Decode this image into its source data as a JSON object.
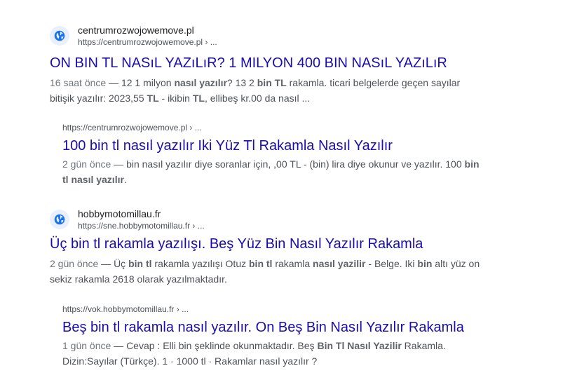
{
  "results": [
    {
      "site_name": "centrumrozwojowemove.pl",
      "url": "https://centrumrozwojowemove.pl › ...",
      "title": "ON BIN TL NASıL YAZıLıR? 1 MILYON 400 BIN NASıL YAZıLıR",
      "date": "16 saat önce",
      "snippet_parts": [
        {
          "t": " — 12 1 milyon ",
          "b": false
        },
        {
          "t": "nasıl yazılır",
          "b": true
        },
        {
          "t": "? 13 2 ",
          "b": false
        },
        {
          "t": "bin TL",
          "b": true
        },
        {
          "t": " rakamla. ticari belgelerde geçen sayılar bitişik yazılır: 2023,55 ",
          "b": false
        },
        {
          "t": "TL",
          "b": true
        },
        {
          "t": " - ikibin ",
          "b": false
        },
        {
          "t": "TL",
          "b": true
        },
        {
          "t": ", ellibeş kr.00 da nasıl ...",
          "b": false
        }
      ]
    },
    {
      "url": "https://centrumrozwojowemove.pl › ...",
      "title": "100 bin tl nasıl yazılır Iki Yüz Tl Rakamla Nasıl Yazılır",
      "date": "2 gün önce",
      "snippet_parts": [
        {
          "t": " — bin nasıl yazılır diye soranlar için, ,00 TL - (bin) lira diye okunur ve yazılır. 100 ",
          "b": false
        },
        {
          "t": "bin tl nasıl yazılır",
          "b": true
        },
        {
          "t": ".",
          "b": false
        }
      ]
    },
    {
      "site_name": "hobbymotomillau.fr",
      "url": "https://sne.hobbymotomillau.fr › ...",
      "title": "Üç bin tl rakamla yazılışı. Beş Yüz Bin Nasıl Yazılır Rakamla",
      "date": "2 gün önce",
      "snippet_parts": [
        {
          "t": " — Üç ",
          "b": false
        },
        {
          "t": "bin tl",
          "b": true
        },
        {
          "t": " rakamla yazılışı Otuz ",
          "b": false
        },
        {
          "t": "bin tl",
          "b": true
        },
        {
          "t": " rakamla ",
          "b": false
        },
        {
          "t": "nasıl yazilir",
          "b": true
        },
        {
          "t": " - Belge. Iki ",
          "b": false
        },
        {
          "t": "bin",
          "b": true
        },
        {
          "t": " altı yüz on sekiz rakamla 2618 olarak yazılmaktadır.",
          "b": false
        }
      ]
    },
    {
      "url": "https://vok.hobbymotomillau.fr › ...",
      "title": "Beş bin tl rakamla nasıl yazılır. On Beş Bin Nasıl Yazılır Rakamla",
      "date": "1 gün önce",
      "snippet_parts": [
        {
          "t": " — Cevap : Elli bin şeklinde okunmaktadır. Beş ",
          "b": false
        },
        {
          "t": "Bin Tl Nasıl Yazilir",
          "b": true
        },
        {
          "t": " Rakamla. Dizin:Sayılar (Türkçe). 1 · 1000 tl · Rakamlar nasıl yazılır ?",
          "b": false
        }
      ]
    }
  ]
}
